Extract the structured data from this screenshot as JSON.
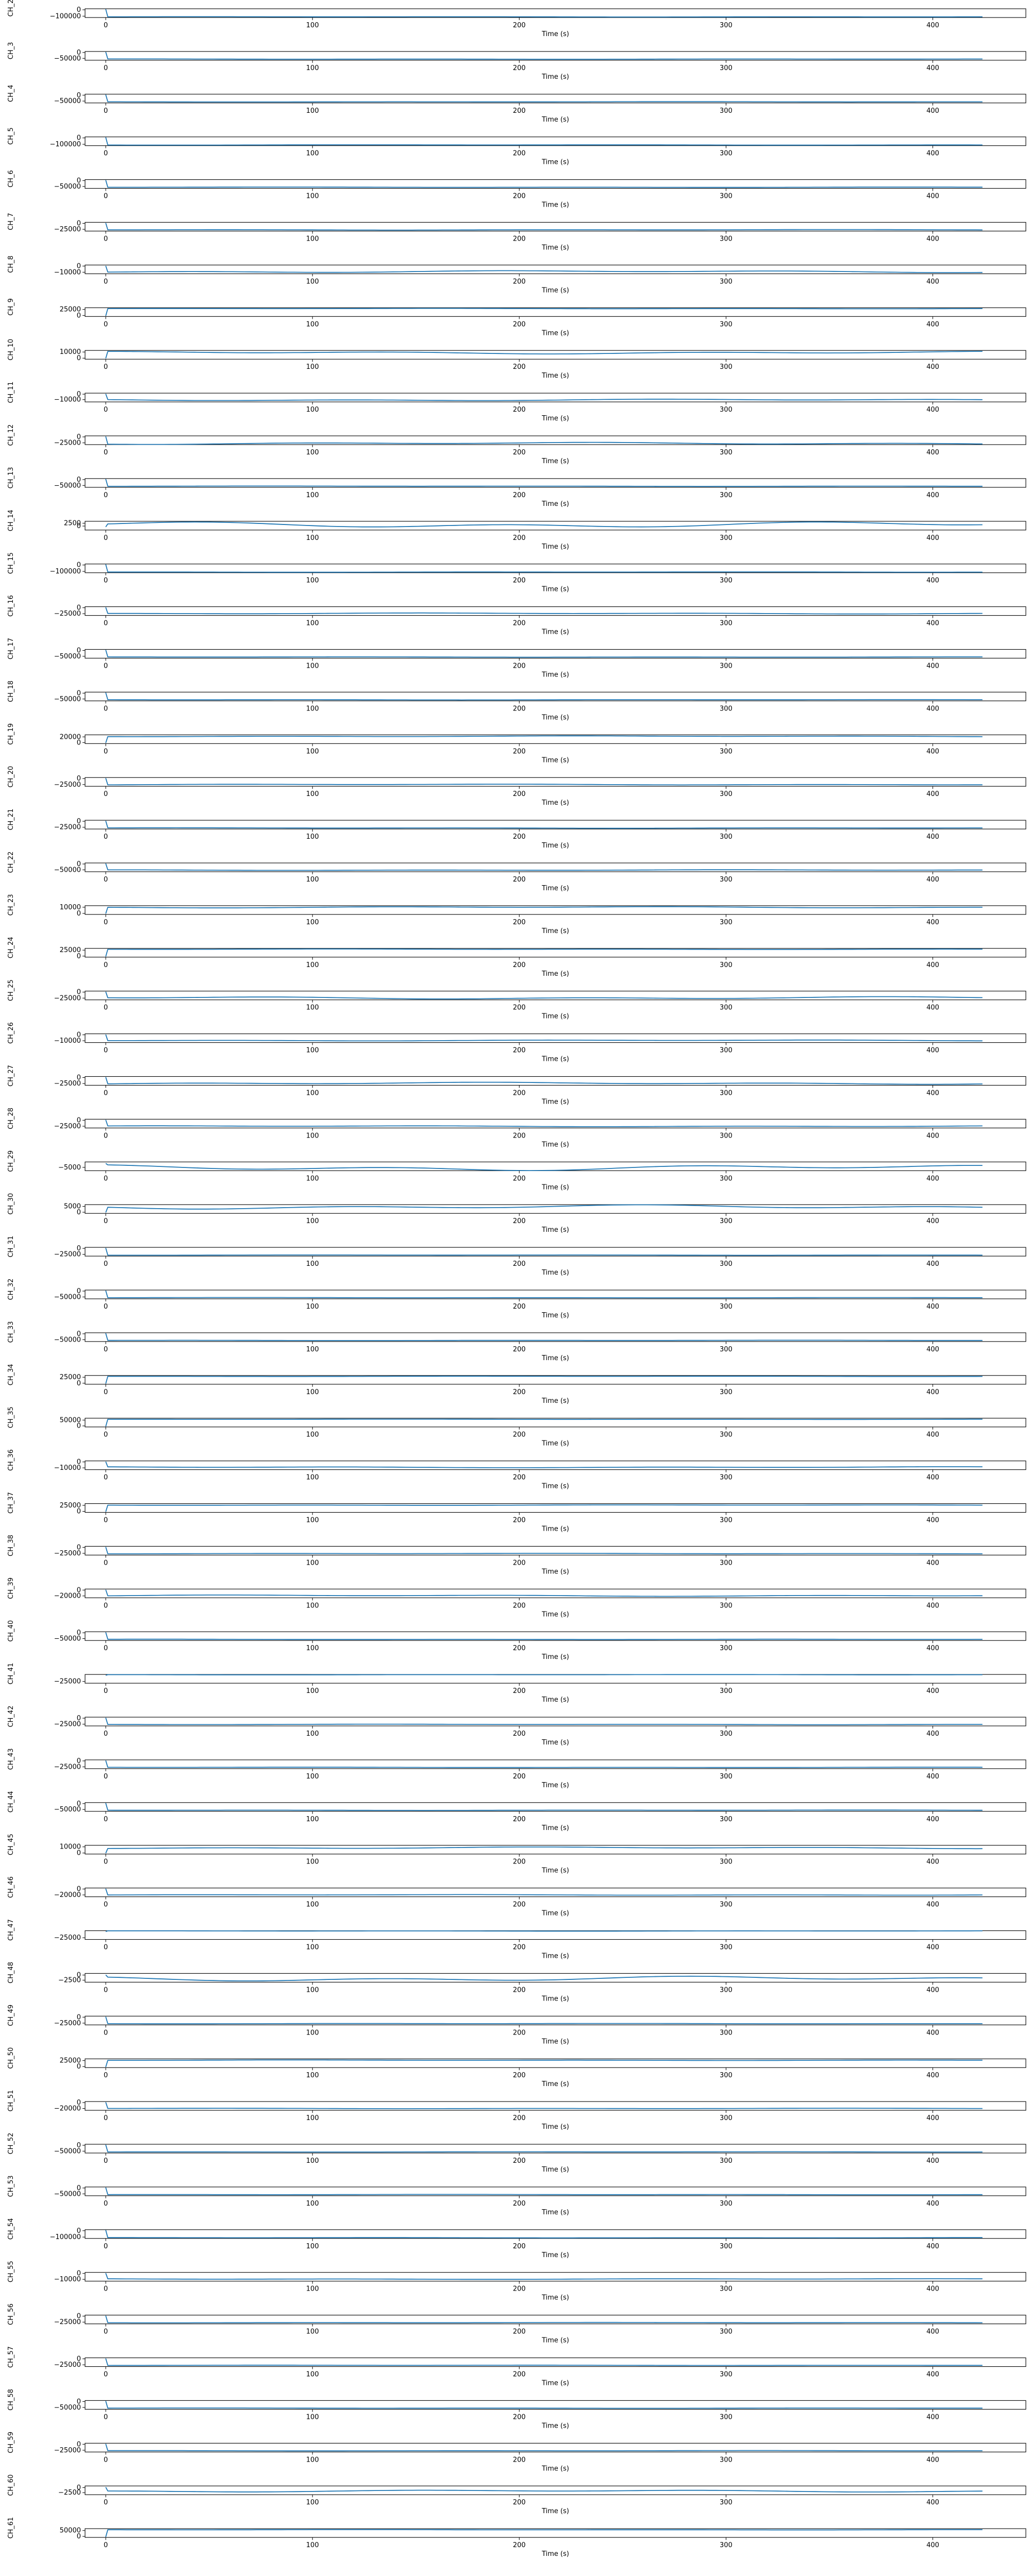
{
  "chart_data": {
    "type": "line",
    "layout": "stacked-subplots",
    "xlabel": "Time (s)",
    "x_ticks": [
      0,
      100,
      200,
      300,
      400
    ],
    "xlim": [
      -10,
      445
    ],
    "x_end": 425,
    "grid": false,
    "series": [
      {
        "name": "CH_2",
        "yticks": [
          0,
          -100000
        ],
        "ylim": [
          -120000,
          8000
        ],
        "start": 2000,
        "level": -110000,
        "wobble": 0.02
      },
      {
        "name": "CH_3",
        "yticks": [
          0,
          -50000
        ],
        "ylim": [
          -65000,
          5000
        ],
        "start": 1000,
        "level": -56000,
        "wobble": 0.02
      },
      {
        "name": "CH_4",
        "yticks": [
          0,
          -50000
        ],
        "ylim": [
          -65000,
          5000
        ],
        "start": 1000,
        "level": -56000,
        "wobble": 0.02
      },
      {
        "name": "CH_5",
        "yticks": [
          0,
          -100000
        ],
        "ylim": [
          -120000,
          8000
        ],
        "start": 2000,
        "level": -110000,
        "wobble": 0.02
      },
      {
        "name": "CH_6",
        "yticks": [
          0,
          -50000
        ],
        "ylim": [
          -65000,
          5000
        ],
        "start": 1000,
        "level": -56000,
        "wobble": 0.02
      },
      {
        "name": "CH_7",
        "yticks": [
          0,
          -25000
        ],
        "ylim": [
          -32000,
          3000
        ],
        "start": 500,
        "level": -27000,
        "wobble": 0.03
      },
      {
        "name": "CH_8",
        "yticks": [
          0,
          -10000
        ],
        "ylim": [
          -12500,
          1500
        ],
        "start": 200,
        "level": -9000,
        "wobble": 0.12
      },
      {
        "name": "CH_9",
        "yticks": [
          25000,
          0
        ],
        "ylim": [
          -3000,
          32000
        ],
        "start": -500,
        "level": 28500,
        "wobble": 0.03
      },
      {
        "name": "CH_10",
        "yticks": [
          10000,
          0
        ],
        "ylim": [
          -1500,
          12500
        ],
        "start": -200,
        "level": 9000,
        "wobble": 0.15
      },
      {
        "name": "CH_11",
        "yticks": [
          0,
          -10000
        ],
        "ylim": [
          -14000,
          1500
        ],
        "start": 200,
        "level": -10500,
        "wobble": 0.1
      },
      {
        "name": "CH_12",
        "yticks": [
          0,
          -25000
        ],
        "ylim": [
          -32000,
          3000
        ],
        "start": 500,
        "level": -27000,
        "wobble": 0.12
      },
      {
        "name": "CH_13",
        "yticks": [
          0,
          -50000
        ],
        "ylim": [
          -65000,
          5000
        ],
        "start": 1000,
        "level": -56000,
        "wobble": 0.02
      },
      {
        "name": "CH_14",
        "yticks": [
          2500,
          0
        ],
        "ylim": [
          -3500,
          4200
        ],
        "start": -800,
        "level": 1200,
        "wobble": 0.35
      },
      {
        "name": "CH_15",
        "yticks": [
          0,
          -100000
        ],
        "ylim": [
          -120000,
          8000
        ],
        "start": 2000,
        "level": -110000,
        "wobble": 0.02
      },
      {
        "name": "CH_16",
        "yticks": [
          0,
          -25000
        ],
        "ylim": [
          -32000,
          3000
        ],
        "start": 500,
        "level": -24000,
        "wobble": 0.06
      },
      {
        "name": "CH_17",
        "yticks": [
          0,
          -50000
        ],
        "ylim": [
          -65000,
          5000
        ],
        "start": 1000,
        "level": -56000,
        "wobble": 0.02
      },
      {
        "name": "CH_18",
        "yticks": [
          0,
          -50000
        ],
        "ylim": [
          -65000,
          5000
        ],
        "start": 1000,
        "level": -56000,
        "wobble": 0.02
      },
      {
        "name": "CH_19",
        "yticks": [
          20000,
          0
        ],
        "ylim": [
          -3000,
          27000
        ],
        "start": -500,
        "level": 22000,
        "wobble": 0.05
      },
      {
        "name": "CH_20",
        "yticks": [
          0,
          -25000
        ],
        "ylim": [
          -32000,
          3000
        ],
        "start": 500,
        "level": -25000,
        "wobble": 0.05
      },
      {
        "name": "CH_21",
        "yticks": [
          0,
          -25000
        ],
        "ylim": [
          -32000,
          3000
        ],
        "start": 500,
        "level": -28000,
        "wobble": 0.03
      },
      {
        "name": "CH_22",
        "yticks": [
          0,
          -50000
        ],
        "ylim": [
          -65000,
          5000
        ],
        "start": 1000,
        "level": -52000,
        "wobble": 0.04
      },
      {
        "name": "CH_23",
        "yticks": [
          10000,
          0
        ],
        "ylim": [
          -1500,
          12500
        ],
        "start": -200,
        "level": 10000,
        "wobble": 0.08
      },
      {
        "name": "CH_24",
        "yticks": [
          25000,
          0
        ],
        "ylim": [
          -3000,
          32000
        ],
        "start": -500,
        "level": 28500,
        "wobble": 0.03
      },
      {
        "name": "CH_25",
        "yticks": [
          0,
          -25000
        ],
        "ylim": [
          -32000,
          3000
        ],
        "start": 500,
        "level": -24000,
        "wobble": 0.14
      },
      {
        "name": "CH_26",
        "yticks": [
          0,
          -10000
        ],
        "ylim": [
          -13000,
          1500
        ],
        "start": 200,
        "level": -9500,
        "wobble": 0.06
      },
      {
        "name": "CH_27",
        "yticks": [
          0,
          -25000
        ],
        "ylim": [
          -32000,
          3000
        ],
        "start": 500,
        "level": -24000,
        "wobble": 0.12
      },
      {
        "name": "CH_28",
        "yticks": [
          0,
          -25000
        ],
        "ylim": [
          -32000,
          3000
        ],
        "start": 500,
        "level": -25000,
        "wobble": 0.06
      },
      {
        "name": "CH_29",
        "yticks": [
          -5000
        ],
        "ylim": [
          -9000,
          1500
        ],
        "start": -200,
        "level": -5500,
        "wobble": 0.35
      },
      {
        "name": "CH_30",
        "yticks": [
          5000,
          0
        ],
        "ylim": [
          -1000,
          6500
        ],
        "start": -200,
        "level": 4500,
        "wobble": 0.25
      },
      {
        "name": "CH_31",
        "yticks": [
          0,
          -25000
        ],
        "ylim": [
          -32000,
          3000
        ],
        "start": 500,
        "level": -28000,
        "wobble": 0.02
      },
      {
        "name": "CH_32",
        "yticks": [
          0,
          -50000
        ],
        "ylim": [
          -65000,
          5000
        ],
        "start": 1000,
        "level": -56000,
        "wobble": 0.02
      },
      {
        "name": "CH_33",
        "yticks": [
          0,
          -50000
        ],
        "ylim": [
          -65000,
          5000
        ],
        "start": 1000,
        "level": -56000,
        "wobble": 0.02
      },
      {
        "name": "CH_34",
        "yticks": [
          25000,
          0
        ],
        "ylim": [
          -3000,
          32000
        ],
        "start": -500,
        "level": 28500,
        "wobble": 0.02
      },
      {
        "name": "CH_35",
        "yticks": [
          50000,
          0
        ],
        "ylim": [
          -5000,
          65000
        ],
        "start": -1000,
        "level": 56000,
        "wobble": 0.02
      },
      {
        "name": "CH_36",
        "yticks": [
          0,
          -10000
        ],
        "ylim": [
          -13000,
          1500
        ],
        "start": 200,
        "level": -9000,
        "wobble": 0.06
      },
      {
        "name": "CH_37",
        "yticks": [
          25000,
          0
        ],
        "ylim": [
          -3000,
          32000
        ],
        "start": -500,
        "level": 26000,
        "wobble": 0.03
      },
      {
        "name": "CH_38",
        "yticks": [
          0,
          -25000
        ],
        "ylim": [
          -32000,
          3000
        ],
        "start": 500,
        "level": -26000,
        "wobble": 0.03
      },
      {
        "name": "CH_39",
        "yticks": [
          0,
          -20000
        ],
        "ylim": [
          -26000,
          2500
        ],
        "start": 400,
        "level": -19000,
        "wobble": 0.08
      },
      {
        "name": "CH_40",
        "yticks": [
          0,
          -50000
        ],
        "ylim": [
          -65000,
          5000
        ],
        "start": 1000,
        "level": -56000,
        "wobble": 0.02
      },
      {
        "name": "CH_41",
        "yticks": [
          -25000
        ],
        "ylim": [
          -32000,
          3000
        ],
        "start": -500,
        "level": 2000,
        "wobble": 0.02
      },
      {
        "name": "CH_42",
        "yticks": [
          0,
          -25000
        ],
        "ylim": [
          -32000,
          3000
        ],
        "start": 500,
        "level": -26000,
        "wobble": 0.03
      },
      {
        "name": "CH_43",
        "yticks": [
          0,
          -25000
        ],
        "ylim": [
          -32000,
          3000
        ],
        "start": 500,
        "level": -27000,
        "wobble": 0.02
      },
      {
        "name": "CH_44",
        "yticks": [
          0,
          -50000
        ],
        "ylim": [
          -65000,
          5000
        ],
        "start": 1000,
        "level": -56000,
        "wobble": 0.02
      },
      {
        "name": "CH_45",
        "yticks": [
          10000,
          0
        ],
        "ylim": [
          -1500,
          12500
        ],
        "start": -200,
        "level": 8500,
        "wobble": 0.1
      },
      {
        "name": "CH_46",
        "yticks": [
          0,
          -20000
        ],
        "ylim": [
          -26000,
          2500
        ],
        "start": 400,
        "level": -20000,
        "wobble": 0.04
      },
      {
        "name": "CH_47",
        "yticks": [
          -25000
        ],
        "ylim": [
          -32000,
          3000
        ],
        "start": -500,
        "level": 2000,
        "wobble": 0.02
      },
      {
        "name": "CH_48",
        "yticks": [
          0,
          -2500
        ],
        "ylim": [
          -3500,
          800
        ],
        "start": 100,
        "level": -1800,
        "wobble": 0.3
      },
      {
        "name": "CH_49",
        "yticks": [
          0,
          -25000
        ],
        "ylim": [
          -32000,
          3000
        ],
        "start": 500,
        "level": -27000,
        "wobble": 0.02
      },
      {
        "name": "CH_50",
        "yticks": [
          25000,
          0
        ],
        "ylim": [
          -3000,
          32000
        ],
        "start": -500,
        "level": 26500,
        "wobble": 0.03
      },
      {
        "name": "CH_51",
        "yticks": [
          0,
          -20000
        ],
        "ylim": [
          -26000,
          2500
        ],
        "start": 400,
        "level": -20000,
        "wobble": 0.03
      },
      {
        "name": "CH_52",
        "yticks": [
          0,
          -50000
        ],
        "ylim": [
          -65000,
          5000
        ],
        "start": 1000,
        "level": -56000,
        "wobble": 0.02
      },
      {
        "name": "CH_53",
        "yticks": [
          0,
          -50000
        ],
        "ylim": [
          -65000,
          5000
        ],
        "start": 1000,
        "level": -56000,
        "wobble": 0.02
      },
      {
        "name": "CH_54",
        "yticks": [
          0,
          -100000
        ],
        "ylim": [
          -120000,
          8000
        ],
        "start": 2000,
        "level": -110000,
        "wobble": 0.02
      },
      {
        "name": "CH_55",
        "yticks": [
          0,
          -10000
        ],
        "ylim": [
          -13000,
          1500
        ],
        "start": 200,
        "level": -9500,
        "wobble": 0.04
      },
      {
        "name": "CH_56",
        "yticks": [
          0,
          -25000
        ],
        "ylim": [
          -32000,
          3000
        ],
        "start": 500,
        "level": -27000,
        "wobble": 0.02
      },
      {
        "name": "CH_57",
        "yticks": [
          0,
          -25000
        ],
        "ylim": [
          -32000,
          3000
        ],
        "start": 500,
        "level": -27000,
        "wobble": 0.02
      },
      {
        "name": "CH_58",
        "yticks": [
          0,
          -50000
        ],
        "ylim": [
          -65000,
          5000
        ],
        "start": 1000,
        "level": -56000,
        "wobble": 0.02
      },
      {
        "name": "CH_59",
        "yticks": [
          0,
          -25000
        ],
        "ylim": [
          -32000,
          3000
        ],
        "start": 500,
        "level": -27000,
        "wobble": 0.02
      },
      {
        "name": "CH_60",
        "yticks": [
          0,
          -2500
        ],
        "ylim": [
          -3500,
          800
        ],
        "start": 200,
        "level": -1700,
        "wobble": 0.12
      },
      {
        "name": "CH_61",
        "yticks": [
          50000,
          0
        ],
        "ylim": [
          -5000,
          65000
        ],
        "start": -1000,
        "level": 56000,
        "wobble": 0.02
      }
    ]
  }
}
